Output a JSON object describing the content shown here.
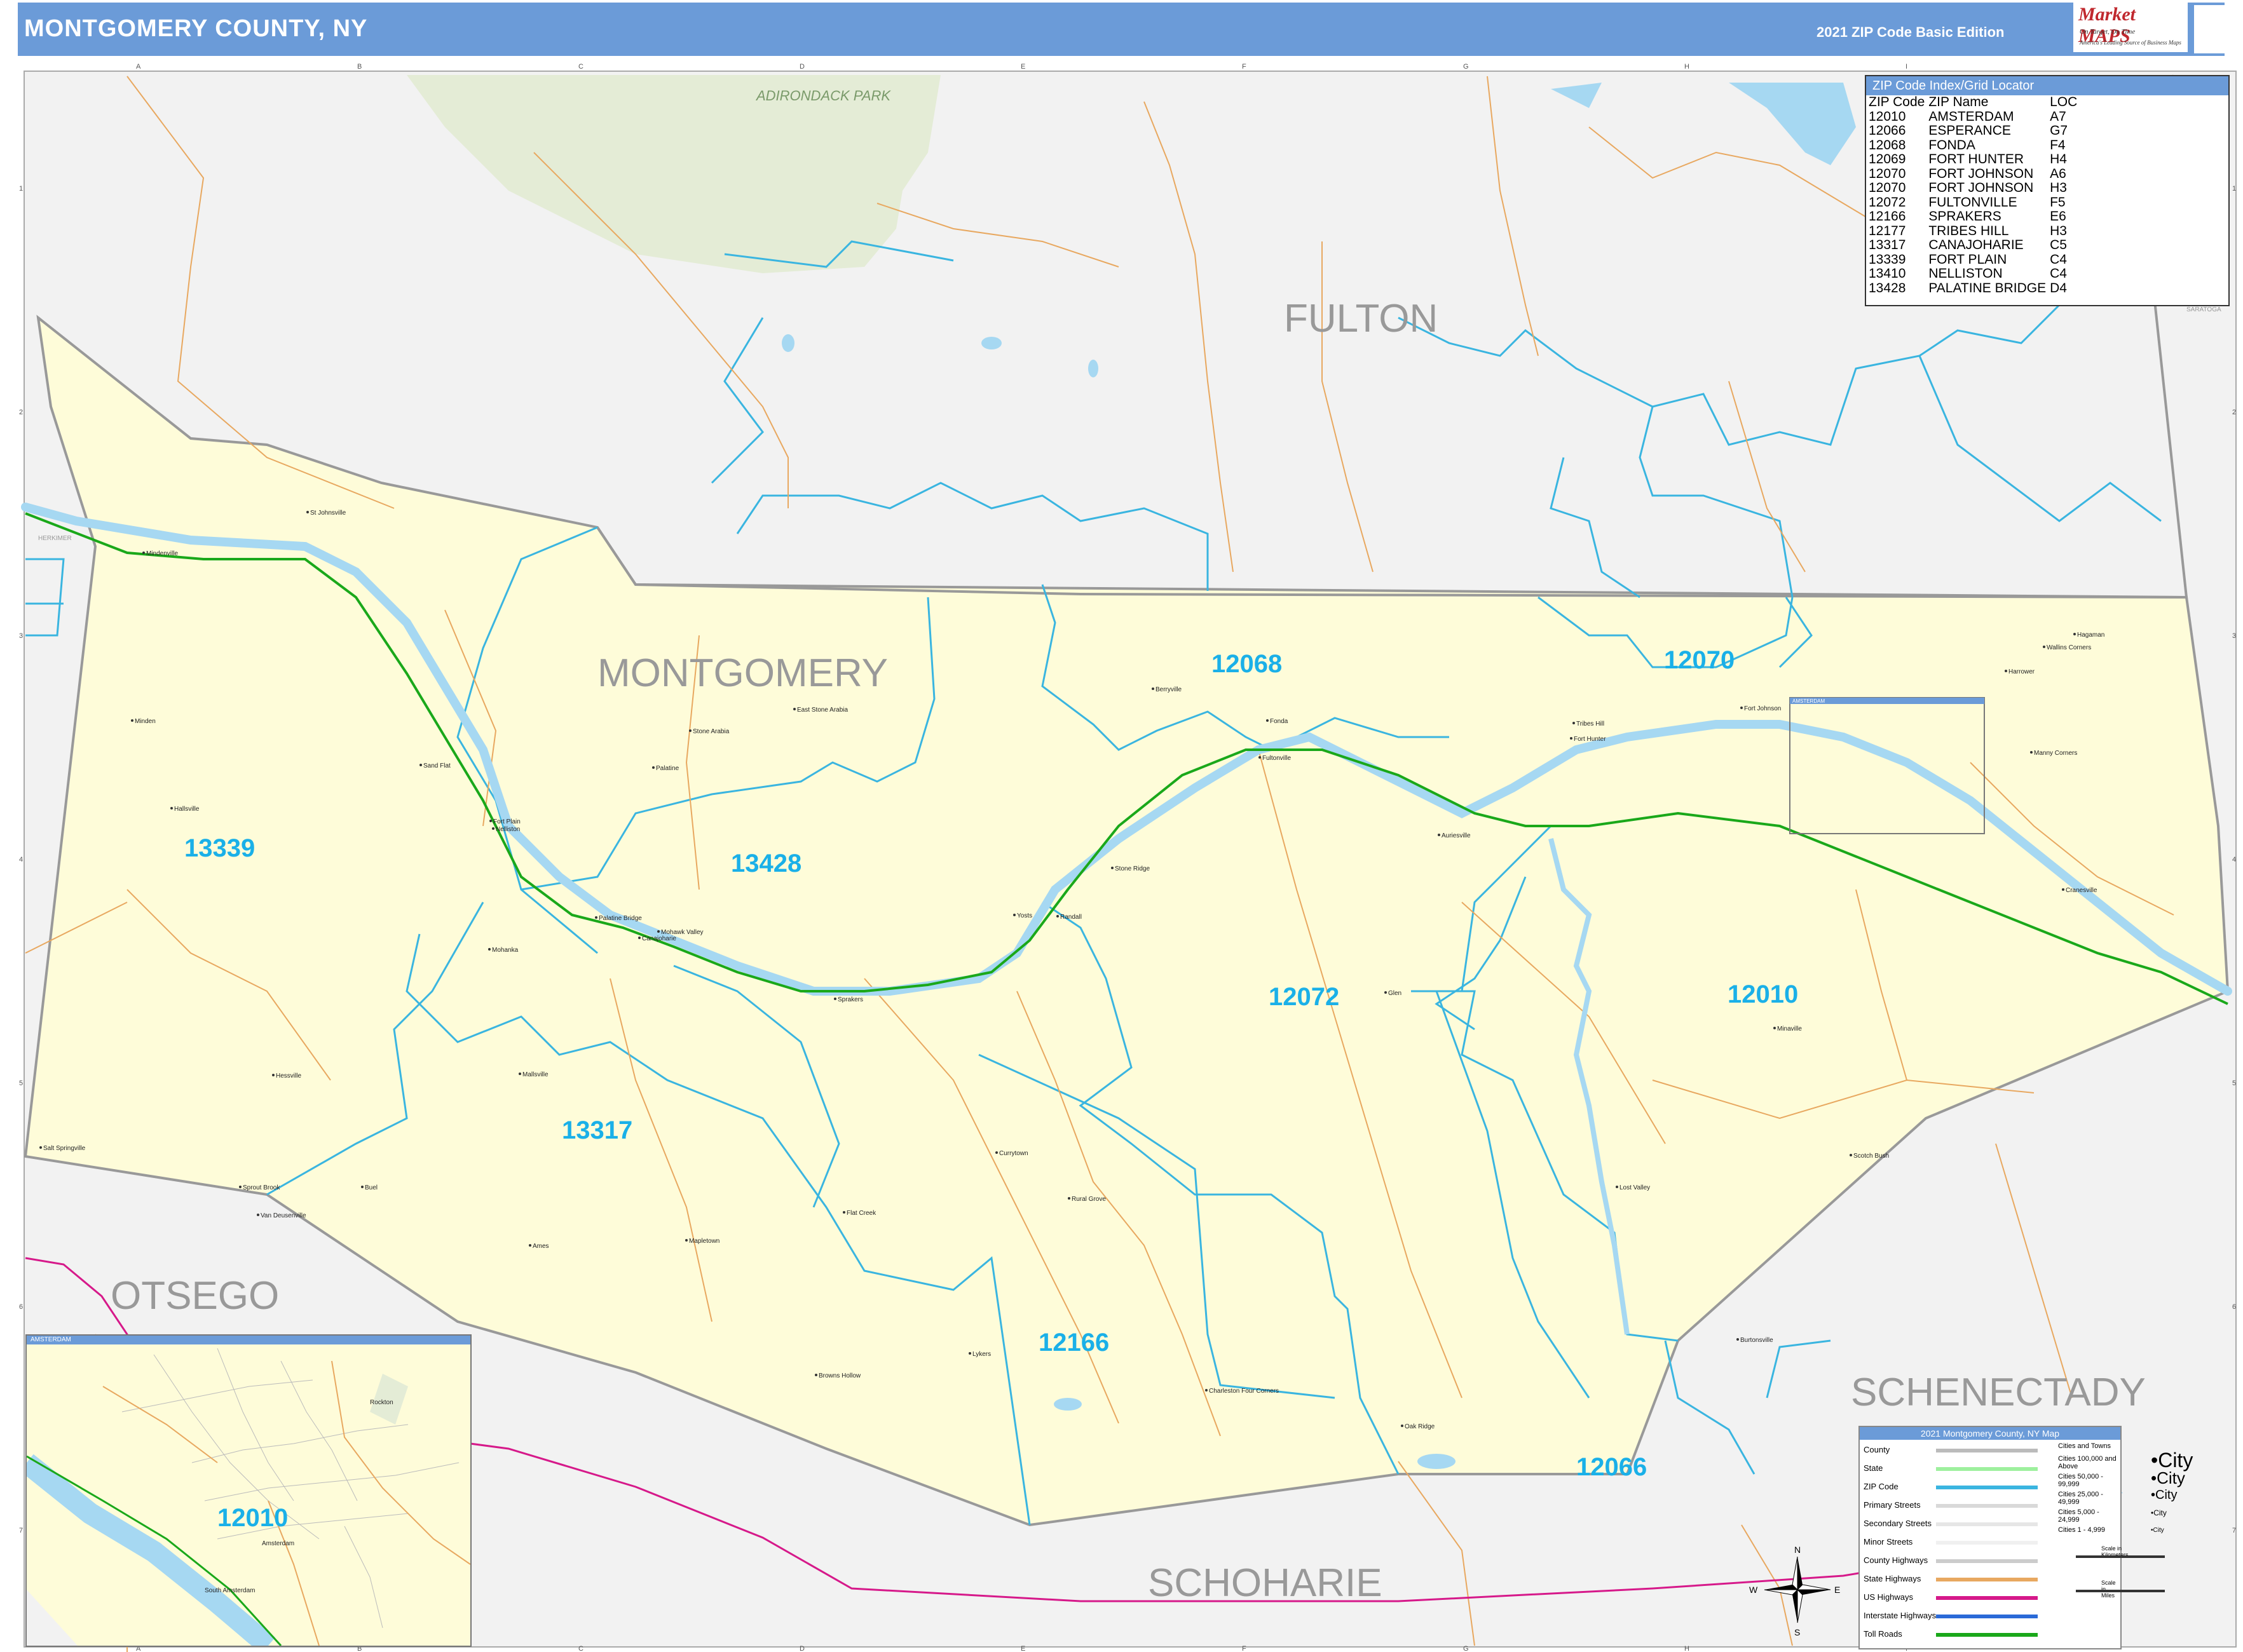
{
  "header": {
    "title": "MONTGOMERY COUNTY, NY",
    "edition": "2021 ZIP Code Basic Edition",
    "logo": "Market MAPS",
    "logo_tagline": "On Target, On Time",
    "logo_tagline2": "America's Leading Source of Business Maps"
  },
  "grid": {
    "columns": [
      "A",
      "B",
      "C",
      "D",
      "E",
      "F",
      "G",
      "H",
      "I"
    ],
    "rows": [
      "1",
      "2",
      "3",
      "4",
      "5",
      "6",
      "7"
    ]
  },
  "counties": {
    "montgomery": "MONTGOMERY",
    "fulton": "FULTON",
    "otsego": "OTSEGO",
    "schenectady": "SCHENECTADY",
    "schoharie": "SCHOHARIE",
    "park": "ADIRONDACK PARK",
    "herkimer": "HERKIMER",
    "saratoga": "SARATOGA"
  },
  "zip_labels": {
    "z13339": "13339",
    "z13428": "13428",
    "z12068": "12068",
    "z12070": "12070",
    "z12072": "12072",
    "z12010": "12010",
    "z13317": "13317",
    "z12166": "12166",
    "z12066": "12066",
    "z12010_inset": "12010"
  },
  "places": [
    "St Johnsville",
    "Mindenville",
    "Minden",
    "Hallsville",
    "Fort Plain",
    "Nelliston",
    "Sand Flat",
    "Palatine",
    "Stone Arabia",
    "East Stone Arabia",
    "Palatine Bridge",
    "Canajoharie",
    "Mohawk Valley",
    "Sprakers",
    "Yosts",
    "Randall",
    "Stone Ridge",
    "Berryville",
    "Fonda",
    "Fultonville",
    "Auriesville",
    "Tribes Hill",
    "Fort Hunter",
    "Fort Johnson",
    "Hagaman",
    "Harrower",
    "Manny Corners",
    "Cranesville",
    "Minaville",
    "Glen",
    "Scotch Bush",
    "Lost Valley",
    "Burtonsville",
    "Oak Ridge",
    "Charleston Four Corners",
    "Rural Grove",
    "Currytown",
    "Flat Creek",
    "Lykers",
    "Browns Hollow",
    "Mapletown",
    "Ames",
    "Hessville",
    "Mallsville",
    "Salt Springville",
    "Sprout Brook",
    "Buel",
    "Van Deusenville",
    "Mohanka",
    "Amsterdam",
    "South Amsterdam",
    "Rockton",
    "Wallins Corners"
  ],
  "zip_table": {
    "title": "ZIP Code Index/Grid Locator",
    "headers": [
      "ZIP Code",
      "ZIP Name",
      "LOC"
    ],
    "rows": [
      [
        "12010",
        "AMSTERDAM",
        "A7"
      ],
      [
        "12066",
        "ESPERANCE",
        "G7"
      ],
      [
        "12068",
        "FONDA",
        "F4"
      ],
      [
        "12069",
        "FORT HUNTER",
        "H4"
      ],
      [
        "12070",
        "FORT JOHNSON",
        "A6"
      ],
      [
        "12070",
        "FORT JOHNSON",
        "H3"
      ],
      [
        "12072",
        "FULTONVILLE",
        "F5"
      ],
      [
        "12166",
        "SPRAKERS",
        "E6"
      ],
      [
        "12177",
        "TRIBES HILL",
        "H3"
      ],
      [
        "13317",
        "CANAJOHARIE",
        "C5"
      ],
      [
        "13339",
        "FORT PLAIN",
        "C4"
      ],
      [
        "13410",
        "NELLISTON",
        "C4"
      ],
      [
        "13428",
        "PALATINE BRIDGE",
        "D4"
      ]
    ]
  },
  "legend": {
    "title": "2021 Montgomery County, NY Map",
    "rows": [
      "County",
      "State",
      "ZIP Code",
      "Primary Streets",
      "Secondary Streets",
      "Minor Streets",
      "County Highways",
      "State Highways",
      "US Highways",
      "Interstate Highways",
      "Toll Roads"
    ],
    "city_header": "Cities and Towns",
    "city_rows": [
      "Cities 100,000 and Above",
      "Cities 50,000 - 99,999",
      "Cities 25,000 - 49,999",
      "Cities 5,000 - 24,999",
      "Cities 1 - 4,999"
    ],
    "city_sample": "City",
    "scale_km": "Scale in Kilometers",
    "scale_mi": "Scale in Miles"
  },
  "compass": {
    "n": "N",
    "s": "S",
    "e": "E",
    "w": "W"
  },
  "inset": {
    "title": "AMSTERDAM"
  },
  "colors": {
    "header": "#6b9bd8",
    "county_fill": "#fefcd9",
    "outside_fill": "#f2f2f2",
    "park_fill": "#e4ecd6",
    "zip_line": "#3ab5e0",
    "river": "#a6d8f2",
    "road": "#e8a860",
    "interstate": "#1aa81a",
    "us_highway": "#d6198a"
  }
}
